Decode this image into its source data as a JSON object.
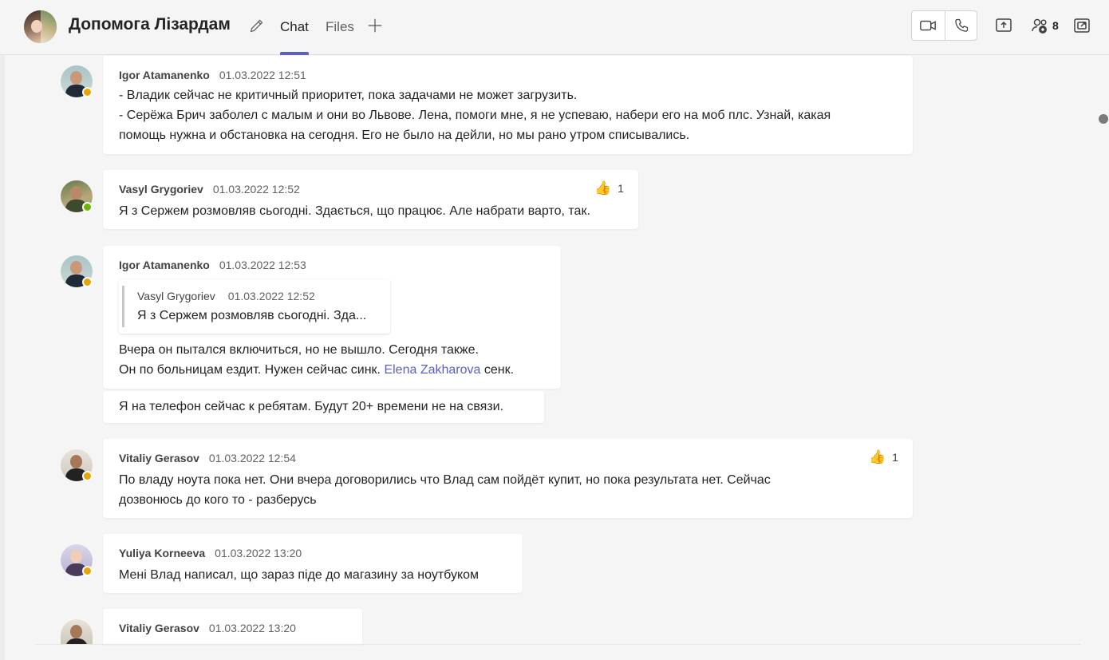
{
  "header": {
    "title": "Допомога Лізардам",
    "tabs": [
      {
        "label": "Chat",
        "active": true
      },
      {
        "label": "Files",
        "active": false
      }
    ],
    "participants_count": "8",
    "accent": "#5b5fc7"
  },
  "messages": [
    {
      "author": "Igor Atamanenko",
      "time": "01.03.2022 12:51",
      "status": "away",
      "lines": [
        "- Владик сейчас не критичный приоритет, пока задачами не может загрузить.",
        "- Серёжа Брич заболел с малым и они во Львове. Лена, помоги мне, я не успеваю, набери его на моб плс. Узнай, какая",
        "помощь нужна и обстановка на сегодня. Его не было на дейли, но мы рано утром списывались."
      ]
    },
    {
      "author": "Vasyl Grygoriev",
      "time": "01.03.2022 12:52",
      "status": "available",
      "reaction": {
        "icon": "thumbs-up-icon",
        "count": "1"
      },
      "lines": [
        "Я з Сержем розмовляв сьогодні. Здається, що працює. Але набрати варто, так."
      ]
    },
    {
      "author": "Igor Atamanenko",
      "time": "01.03.2022 12:53",
      "status": "away",
      "quote": {
        "author": "Vasyl Grygoriev",
        "time": "01.03.2022 12:52",
        "text": "Я з Сержем розмовляв сьогодні. Зда..."
      },
      "lines": [
        "Вчера он пытался включиться, но не вышло. Сегодня также.",
        "Он по больницам ездит. Нужен сейчас синк."
      ],
      "mention": "Elena Zakharova",
      "mention_suffix": " сенк.",
      "followup": "Я на телефон сейчас к ребятам. Будут 20+ времени не на связи."
    },
    {
      "author": "Vitaliy Gerasov",
      "time": "01.03.2022 12:54",
      "status": "away",
      "reaction": {
        "icon": "thumbs-up-icon",
        "count": "1"
      },
      "lines": [
        "По владу ноута пока нет. Они вчера договорились что Влад сам пойдёт купит, но пока результата нет. Сейчас",
        "дозвонюсь до кого то - разберусь"
      ]
    },
    {
      "author": "Yuliya Korneeva",
      "time": "01.03.2022 13:20",
      "status": "away",
      "lines": [
        "Мені Влад написал, що зараз піде до магазину за ноутбуком"
      ]
    },
    {
      "author": "Vitaliy Gerasov",
      "time": "01.03.2022 13:20",
      "status": "away",
      "lines": []
    }
  ]
}
